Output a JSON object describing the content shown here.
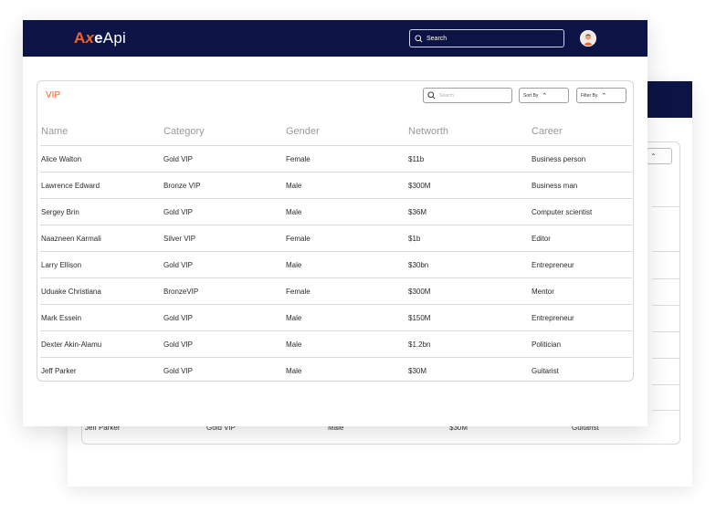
{
  "app": {
    "logo": {
      "a": "A",
      "x": "x",
      "e": "e",
      "api": "Api"
    },
    "search_placeholder": "Search"
  },
  "panel": {
    "title": "VIP",
    "search_placeholder": "Search",
    "sort_label": "Sort By",
    "filter_label": "Filter By"
  },
  "table": {
    "headers": [
      "Name",
      "Category",
      "Gender",
      "Networth",
      "Career"
    ],
    "rows": [
      [
        "Alice Walton",
        "Gold VIP",
        "Female",
        "$11b",
        "Business person"
      ],
      [
        "Lawrence Edward",
        "Bronze VIP",
        "Male",
        "$300M",
        "Business man"
      ],
      [
        "Sergey Brin",
        "Gold VIP",
        "Male",
        "$36M",
        "Computer scientist"
      ],
      [
        "Naazneen Karmali",
        "Silver VIP",
        "Female",
        "$1b",
        "Editor"
      ],
      [
        "Larry Ellison",
        "Gold VIP",
        "Male",
        "$30bn",
        "Entrepreneur"
      ],
      [
        "Uduake Christiana",
        "BronzeVIP",
        "Female",
        "$300M",
        "Mentor"
      ],
      [
        "Mark Essein",
        "Gold VIP",
        "Male",
        "$150M",
        "Entrepreneur"
      ],
      [
        "Dexter Akin-Alamu",
        "Gold VIP",
        "Male",
        "$1.2bn",
        "Politician"
      ],
      [
        "Jeff Parker",
        "Gold VIP",
        "Male",
        "$30M",
        "Guitarist"
      ]
    ]
  },
  "back_card": {
    "last_row": [
      "Jeff Parker",
      "Gold VIP",
      "Male",
      "$30M",
      "Guitarist"
    ]
  },
  "colors": {
    "navy": "#0c1446",
    "accent": "#f0632b"
  }
}
